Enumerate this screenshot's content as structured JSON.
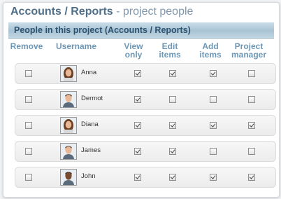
{
  "page": {
    "title_main": "Accounts / Reports",
    "title_sub": " - project people",
    "banner": "People in this project (Accounts / Reports)"
  },
  "columns": [
    {
      "id": "remove",
      "label": "Remove"
    },
    {
      "id": "username",
      "label": "Username"
    },
    {
      "id": "view_only",
      "label": "View\nonly"
    },
    {
      "id": "edit_items",
      "label": "Edit\nitems"
    },
    {
      "id": "add_items",
      "label": "Add\nitems"
    },
    {
      "id": "project_manager",
      "label": "Project\nmanager"
    }
  ],
  "people": [
    {
      "name": "Anna",
      "avatar": "female-user-avatar",
      "remove": false,
      "view_only": true,
      "edit_items": true,
      "add_items": true,
      "project_manager": false
    },
    {
      "name": "Dermot",
      "avatar": "male-user-avatar",
      "remove": false,
      "view_only": true,
      "edit_items": false,
      "add_items": false,
      "project_manager": false
    },
    {
      "name": "Diana",
      "avatar": "female-user-avatar",
      "remove": false,
      "view_only": true,
      "edit_items": true,
      "add_items": true,
      "project_manager": true
    },
    {
      "name": "James",
      "avatar": "male-user-avatar",
      "remove": false,
      "view_only": true,
      "edit_items": true,
      "add_items": false,
      "project_manager": false
    },
    {
      "name": "John",
      "avatar": "male-user-avatar",
      "remove": false,
      "view_only": true,
      "edit_items": true,
      "add_items": true,
      "project_manager": true
    }
  ],
  "colors": {
    "title": "#4f6f8a",
    "header": "#6d97b6",
    "banner_text": "#2c5270"
  }
}
